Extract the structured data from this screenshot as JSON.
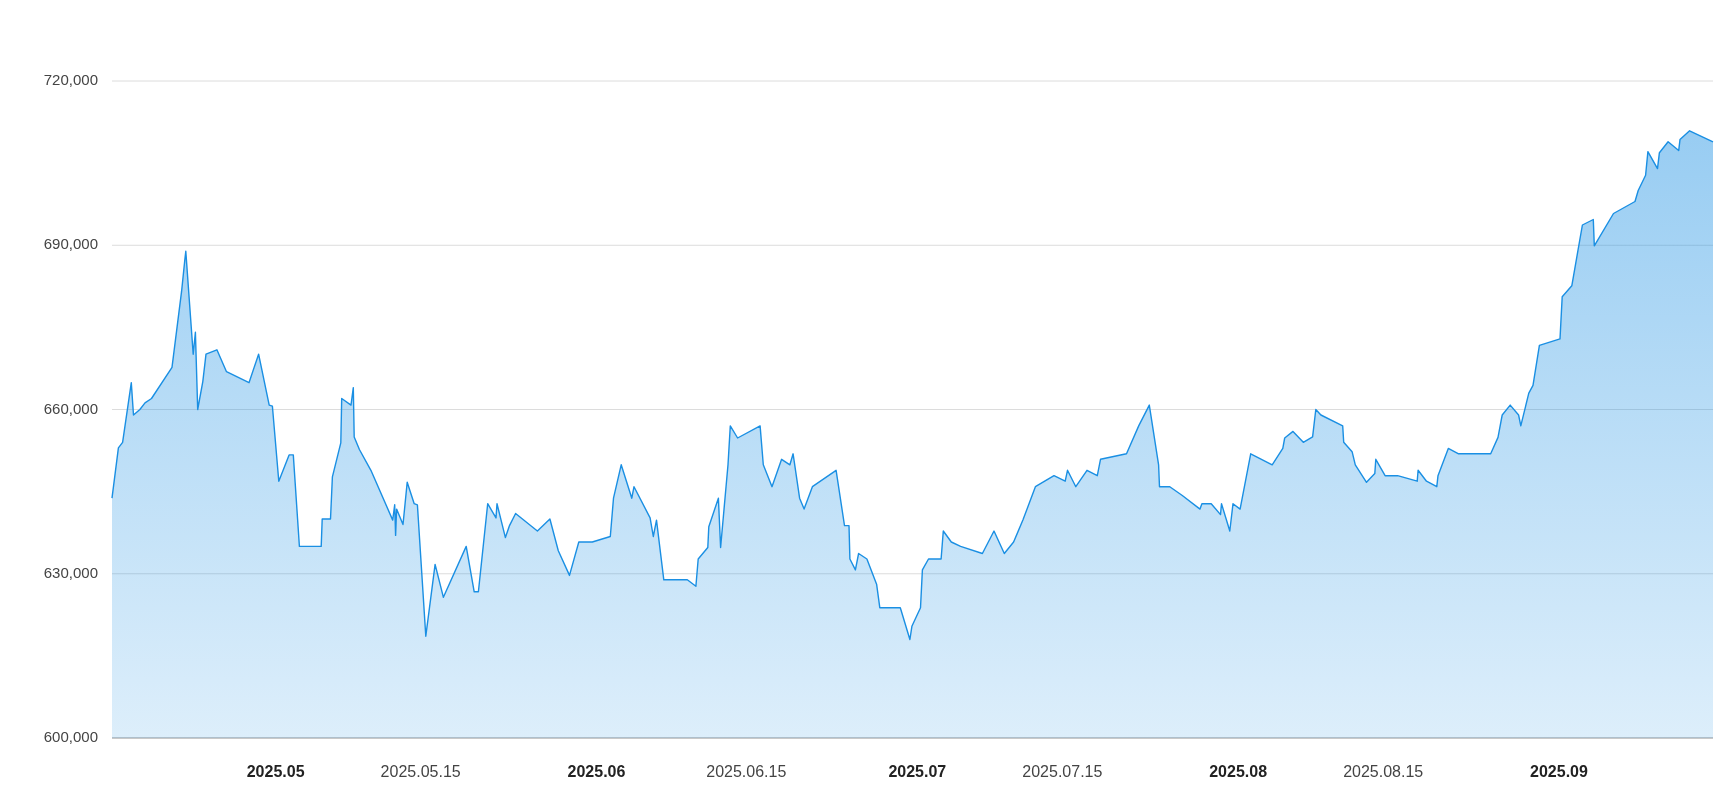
{
  "chart_data": {
    "type": "area",
    "grid": true,
    "xlim": [
      2025.0449,
      2025.0948
    ],
    "ylim": [
      600000,
      720000
    ],
    "yticks": [
      {
        "value": 600000,
        "label": "600,000"
      },
      {
        "value": 630000,
        "label": "630,000"
      },
      {
        "value": 660000,
        "label": "660,000"
      },
      {
        "value": 690000,
        "label": "690,000"
      },
      {
        "value": 720000,
        "label": "720,000"
      }
    ],
    "xticks": [
      {
        "value": 2025.05,
        "label": "**2025.05**"
      },
      {
        "value": 2025.05452,
        "label": "2025.05.15"
      },
      {
        "value": 2025.06,
        "label": "**2025.06**"
      },
      {
        "value": 2025.06467,
        "label": "2025.06.15"
      },
      {
        "value": 2025.07,
        "label": "**2025.07**"
      },
      {
        "value": 2025.07452,
        "label": "2025.07.15"
      },
      {
        "value": 2025.08,
        "label": "**2025.08**"
      },
      {
        "value": 2025.08452,
        "label": "2025.08.15"
      },
      {
        "value": 2025.09,
        "label": "**2025.09**"
      }
    ],
    "x": [
      2025.0449,
      2025.0451,
      2025.04523,
      2025.04533,
      2025.0455,
      2025.04557,
      2025.04577,
      2025.04593,
      2025.04613,
      2025.04677,
      2025.04707,
      2025.04717,
      2025.0472,
      2025.04743,
      2025.0475,
      2025.04757,
      2025.04773,
      2025.04783,
      2025.04817,
      2025.04847,
      2025.04917,
      2025.04947,
      2025.0498,
      2025.0499,
      2025.0501,
      2025.05042,
      2025.05055,
      2025.05074,
      2025.05142,
      2025.05145,
      2025.05171,
      2025.05177,
      2025.05203,
      2025.05206,
      2025.05235,
      2025.05242,
      2025.05245,
      2025.05261,
      2025.05297,
      2025.05365,
      2025.05371,
      2025.05374,
      2025.05377,
      2025.05397,
      2025.0541,
      2025.05432,
      2025.05442,
      2025.05468,
      2025.05497,
      2025.05523,
      2025.05594,
      2025.05619,
      2025.05632,
      2025.05661,
      2025.05687,
      2025.0569,
      2025.05716,
      2025.05729,
      2025.05748,
      2025.05816,
      2025.05855,
      2025.05881,
      2025.05916,
      2025.05945,
      2025.05987,
      2025.06043,
      2025.06053,
      2025.06077,
      2025.0611,
      2025.06117,
      2025.06167,
      2025.06177,
      2025.06187,
      2025.0621,
      2025.06283,
      2025.0631,
      2025.06317,
      2025.06347,
      2025.0635,
      2025.0638,
      2025.06387,
      2025.0641,
      2025.06417,
      2025.0644,
      2025.0651,
      2025.0652,
      2025.06547,
      2025.06577,
      2025.06603,
      2025.06613,
      2025.06633,
      2025.06647,
      2025.06673,
      2025.06747,
      2025.06773,
      2025.06787,
      2025.0679,
      2025.06807,
      2025.06817,
      2025.06843,
      2025.06873,
      2025.06883,
      2025.06947,
      2025.06977,
      2025.06983,
      2025.0701,
      2025.07016,
      2025.07035,
      2025.07074,
      2025.07081,
      2025.07106,
      2025.07135,
      2025.07203,
      2025.07239,
      2025.07271,
      2025.073,
      2025.07329,
      2025.07368,
      2025.07426,
      2025.07461,
      2025.07468,
      2025.07494,
      2025.07529,
      2025.07561,
      2025.07571,
      2025.07652,
      2025.0769,
      2025.07723,
      2025.07752,
      2025.07755,
      2025.07787,
      2025.07826,
      2025.07881,
      2025.07887,
      2025.07916,
      2025.07945,
      2025.07948,
      2025.07974,
      2025.07984,
      2025.08006,
      2025.08039,
      2025.08106,
      2025.08139,
      2025.08145,
      2025.08171,
      2025.08203,
      2025.08232,
      2025.08242,
      2025.08258,
      2025.08326,
      2025.08329,
      2025.08355,
      2025.08365,
      2025.084,
      2025.08426,
      2025.08429,
      2025.08458,
      2025.08497,
      2025.08558,
      2025.08561,
      2025.08587,
      2025.08619,
      2025.08623,
      2025.08655,
      2025.08687,
      2025.08787,
      2025.0881,
      2025.08823,
      2025.08848,
      2025.08874,
      2025.08881,
      2025.08906,
      2025.08919,
      2025.08939,
      2025.09003,
      2025.0901,
      2025.0904,
      2025.09073,
      2025.09107,
      2025.0911,
      2025.0917,
      2025.09237,
      2025.09247,
      2025.0927,
      2025.09277,
      2025.09307,
      2025.09313,
      2025.0934,
      2025.09373,
      2025.09377,
      2025.09407,
      2025.0948
    ],
    "series": [
      {
        "color": "#1a8fe3",
        "values": [
          643800,
          653000,
          654000,
          658000,
          664900,
          659000,
          660000,
          661200,
          662000,
          667700,
          681600,
          687300,
          688900,
          670100,
          674100,
          660000,
          665100,
          670100,
          670900,
          666900,
          664900,
          670100,
          660800,
          660600,
          646900,
          651700,
          651700,
          635000,
          635000,
          640000,
          640000,
          647700,
          653900,
          662000,
          660800,
          664000,
          655000,
          652700,
          648900,
          639800,
          642600,
          637000,
          641800,
          639000,
          646700,
          642800,
          642600,
          618600,
          631700,
          625700,
          635000,
          626700,
          626700,
          642800,
          640200,
          642800,
          636600,
          638800,
          641000,
          637800,
          640000,
          634200,
          629700,
          635800,
          635800,
          636800,
          643800,
          649900,
          643800,
          645900,
          640200,
          636800,
          639800,
          628900,
          628900,
          627700,
          632700,
          634800,
          638600,
          643800,
          634800,
          649900,
          657000,
          654800,
          657000,
          649900,
          645900,
          650900,
          649900,
          651900,
          643800,
          641800,
          645900,
          648900,
          638800,
          638800,
          632700,
          630700,
          633700,
          632700,
          628100,
          623800,
          623800,
          618000,
          620400,
          623800,
          630700,
          632700,
          632700,
          637800,
          635800,
          635000,
          633700,
          637800,
          633700,
          635800,
          639800,
          645900,
          647900,
          646900,
          648900,
          645900,
          648900,
          647900,
          650900,
          651900,
          657000,
          660800,
          649900,
          645900,
          645900,
          644300,
          641800,
          642800,
          642800,
          640800,
          642800,
          637800,
          642800,
          641800,
          651900,
          649900,
          652900,
          654800,
          656000,
          654000,
          655000,
          660000,
          659000,
          657000,
          654000,
          652300,
          649900,
          646700,
          648300,
          650900,
          647900,
          647900,
          646900,
          648900,
          646900,
          645900,
          647900,
          652900,
          651900,
          651900,
          654900,
          659000,
          660800,
          659000,
          657000,
          663000,
          664400,
          671700,
          672900,
          680600,
          682600,
          693700,
          694700,
          689900,
          695800,
          698000,
          700000,
          702800,
          707100,
          704000,
          706900,
          708900,
          707300,
          709300,
          710900,
          708900
        ]
      }
    ]
  }
}
